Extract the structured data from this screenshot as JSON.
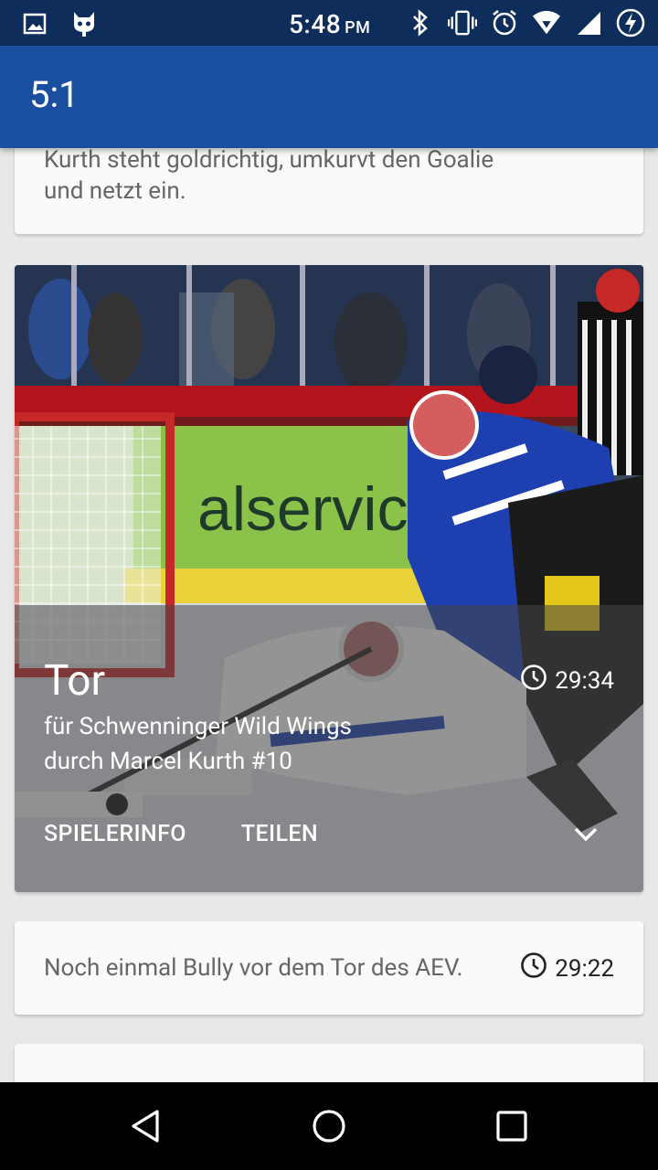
{
  "status_bar": {
    "time": "5:48",
    "ampm": "PM",
    "left_icons": [
      "image-icon",
      "cyanogen-icon"
    ],
    "right_icons": [
      "bluetooth-icon",
      "vibrate-icon",
      "alarm-icon",
      "wifi-icon",
      "signal-icon",
      "battery-charging-icon"
    ]
  },
  "app_bar": {
    "title": "5:1"
  },
  "cards": {
    "top": {
      "text": "Kurth steht goldrichtig, umkurvt den Goalie und netzt ein."
    },
    "goal": {
      "title": "Tor",
      "time": "29:34",
      "subtitle_line1": "für Schwenninger Wild Wings",
      "subtitle_line2": "durch Marcel Kurth #10",
      "action_player": "SPIELERINFO",
      "action_share": "TEILEN",
      "photo_banner": "alservice"
    },
    "event": {
      "text": "Noch einmal Bully vor dem Tor des AEV.",
      "time": "29:22"
    }
  },
  "nav": {
    "buttons": [
      "back",
      "home",
      "recents"
    ]
  }
}
